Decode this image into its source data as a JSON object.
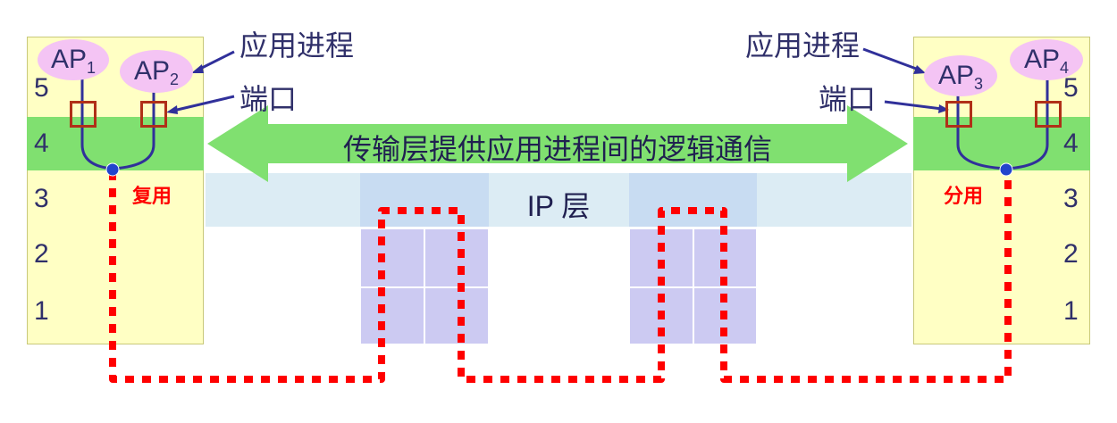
{
  "colors": {
    "stack_bg": "#ffffc4",
    "layer4_band": "#80e070",
    "arrow": "#80e070",
    "ip_band": "#dcecf4",
    "router": "#cccaf2",
    "ap_ellipse": "#f4c4f4",
    "port_box": "#b03018",
    "dotted_path": "#ff0000",
    "text": "#30306a"
  },
  "left_host": {
    "layers": [
      "5",
      "4",
      "3",
      "2",
      "1"
    ],
    "ap1": {
      "main": "AP",
      "sub": "1"
    },
    "ap2": {
      "main": "AP",
      "sub": "2"
    },
    "mux_label": "复用"
  },
  "right_host": {
    "layers": [
      "5",
      "4",
      "3",
      "2",
      "1"
    ],
    "ap3": {
      "main": "AP",
      "sub": "3"
    },
    "ap4": {
      "main": "AP",
      "sub": "4"
    },
    "demux_label": "分用"
  },
  "labels": {
    "process_left": "应用进程",
    "port_left": "端口",
    "process_right": "应用进程",
    "port_right": "端口",
    "transport_arrow": "传输层提供应用进程间的逻辑通信",
    "ip_layer": "IP 层"
  }
}
